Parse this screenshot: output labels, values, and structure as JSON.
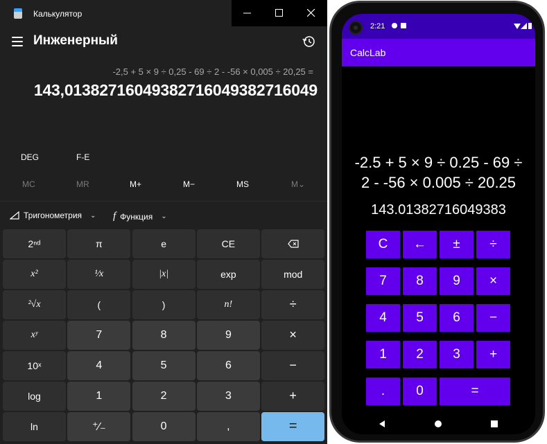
{
  "windows_calc": {
    "window_title": "Калькулятор",
    "mode": "Инженерный",
    "expression": "-2,5 + 5 × 9 ÷ 0,25 - 69 ÷ 2 - -56 × 0,005 ÷ 20,25 =",
    "result": "143,01382716049382716049382716049",
    "angle_mode": "DEG",
    "fe_label": "F-E",
    "memory": [
      "MC",
      "MR",
      "M+",
      "M−",
      "MS",
      "M⌄"
    ],
    "trig_label": "Тригонометрия",
    "func_label": "Функция",
    "keys": [
      [
        "2ⁿᵈ",
        "π",
        "e",
        "CE",
        "⌫"
      ],
      [
        "x²",
        "¹⁄x",
        "|x|",
        "exp",
        "mod"
      ],
      [
        "²√x",
        "(",
        ")",
        "n!",
        "÷"
      ],
      [
        "xʸ",
        "7",
        "8",
        "9",
        "×"
      ],
      [
        "10ˣ",
        "4",
        "5",
        "6",
        "−"
      ],
      [
        "log",
        "1",
        "2",
        "3",
        "+"
      ],
      [
        "ln",
        "⁺∕₋",
        "0",
        ",",
        "="
      ]
    ]
  },
  "android": {
    "time": "2:21",
    "app_title": "CalcLab",
    "expression_line1": "-2.5 + 5 × 9 ÷ 0.25 - 69 ÷",
    "expression_line2": "2 - -56 × 0.005 ÷ 20.25",
    "result": "143.01382716049383",
    "buttons": [
      "C",
      "←",
      "±",
      "÷",
      "7",
      "8",
      "9",
      "×",
      "4",
      "5",
      "6",
      "−",
      "1",
      "2",
      "3",
      "+",
      ".",
      "0",
      "="
    ]
  }
}
